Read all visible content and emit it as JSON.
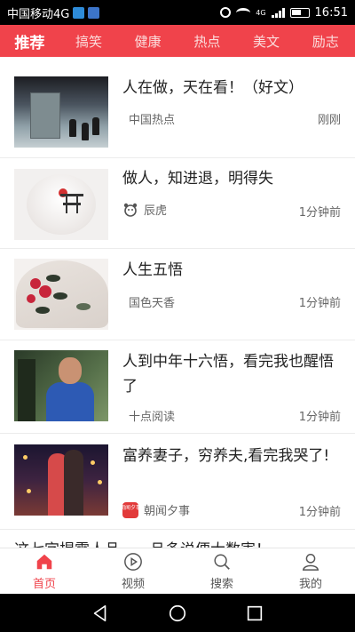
{
  "status_bar": {
    "carrier": "中国移动4G",
    "network": "4G",
    "time": "16:51"
  },
  "tabs": [
    {
      "label": "推荐",
      "active": true
    },
    {
      "label": "搞笑",
      "active": false
    },
    {
      "label": "健康",
      "active": false
    },
    {
      "label": "热点",
      "active": false
    },
    {
      "label": "美文",
      "active": false
    },
    {
      "label": "励志",
      "active": false
    }
  ],
  "feed": {
    "items": [
      {
        "title": "人在做，天在看！（好文）",
        "source": "中国热点",
        "time": "刚刚",
        "source_icon": ""
      },
      {
        "title": "做人，知进退，明得失",
        "source": "辰虎",
        "time": "1分钟前",
        "source_icon": "tiger-logo-icon"
      },
      {
        "title": "人生五悟",
        "source": "国色天香",
        "time": "1分钟前",
        "source_icon": ""
      },
      {
        "title": "人到中年十六悟，看完我也醒悟了",
        "source": "十点阅读",
        "time": "1分钟前",
        "source_icon": ""
      },
      {
        "title": "富养妻子，穷养夫,看完我哭了!",
        "source": "朝闻夕事",
        "time": "1分钟前",
        "source_icon": "news-logo-icon",
        "source_logo_text": "朝闻夕事"
      }
    ],
    "partial_title": "这七字揭露人品，一旦多说便大数害！"
  },
  "bottom_nav": [
    {
      "label": "首页",
      "icon": "home-icon",
      "active": true
    },
    {
      "label": "视频",
      "icon": "play-icon",
      "active": false
    },
    {
      "label": "搜索",
      "icon": "search-icon",
      "active": false
    },
    {
      "label": "我的",
      "icon": "user-icon",
      "active": false
    }
  ],
  "colors": {
    "accent": "#f0434b",
    "tab_bar": "#f0434b"
  }
}
